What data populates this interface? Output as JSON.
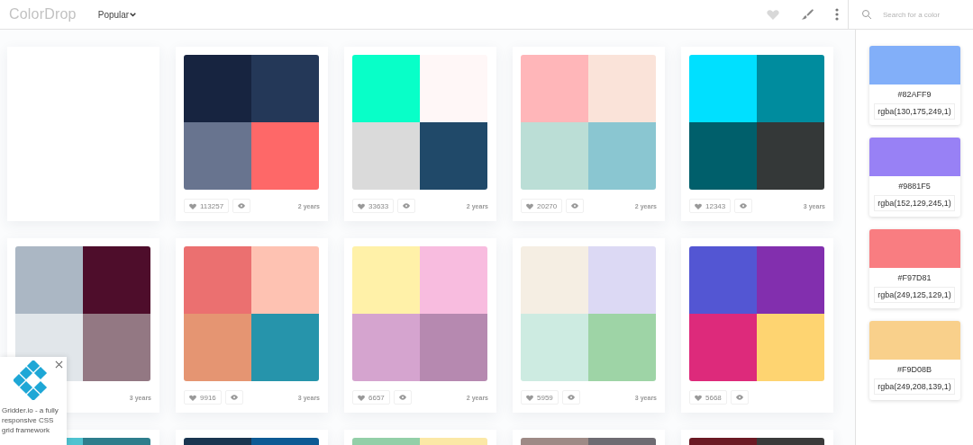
{
  "header": {
    "logo": "ColorDrop",
    "sort": "Popular",
    "search": {
      "placeholder": "Search for a color"
    }
  },
  "cards": [
    {
      "kind": "blank"
    },
    {
      "kind": "palette",
      "swatches": [
        {
          "color": "#172440"
        },
        {
          "color": "#243858"
        },
        {
          "color": "#68748f"
        },
        {
          "color": "#fe6868"
        }
      ],
      "likes": "113257",
      "age": "2 years"
    },
    {
      "kind": "palette",
      "swatches": [
        {
          "color": "#08ffc8"
        },
        {
          "color": "#fff7f7"
        },
        {
          "color": "#dadada"
        },
        {
          "color": "#204969"
        }
      ],
      "likes": "33633",
      "age": "2 years"
    },
    {
      "kind": "palette",
      "swatches": [
        {
          "color": "#ffb6b9"
        },
        {
          "color": "#fae3d9"
        },
        {
          "color": "#bbded6"
        },
        {
          "color": "#8ac6d1"
        }
      ],
      "likes": "20270",
      "age": "2 years"
    },
    {
      "kind": "palette",
      "swatches": [
        {
          "color": "#00e0ff"
        },
        {
          "color": "#008c9e"
        },
        {
          "color": "#005f6b"
        },
        {
          "color": "#343838"
        }
      ],
      "likes": "12343",
      "age": "3 years"
    },
    {
      "kind": "palette",
      "swatches": [
        {
          "color": "#abb7c4"
        },
        {
          "color": "#4e0d2b"
        },
        {
          "color": "#e1e6ea"
        },
        {
          "color": "#937883"
        }
      ],
      "age": "3 years"
    },
    {
      "kind": "palette",
      "swatches": [
        {
          "color": "#eb7070"
        },
        {
          "color": "#fec2b2"
        },
        {
          "color": "#e59572"
        },
        {
          "color": "#2694ab"
        }
      ],
      "likes": "9916",
      "age": "3 years"
    },
    {
      "kind": "palette",
      "swatches": [
        {
          "color": "#fff1a8"
        },
        {
          "color": "#f8bcdf"
        },
        {
          "color": "#d5a4cf"
        },
        {
          "color": "#b689b0"
        }
      ],
      "likes": "6657",
      "age": "2 years"
    },
    {
      "kind": "palette",
      "swatches": [
        {
          "color": "#f5eee3"
        },
        {
          "color": "#dcd9f4"
        },
        {
          "color": "#cdebe1"
        },
        {
          "color": "#9ed4a6"
        }
      ],
      "likes": "5959",
      "age": "3 years"
    },
    {
      "kind": "palette",
      "swatches": [
        {
          "color": "#5356d3"
        },
        {
          "color": "#822fae"
        },
        {
          "color": "#dd2a7b"
        },
        {
          "color": "#fed471"
        }
      ],
      "likes": "5668"
    },
    {
      "kind": "palette",
      "swatches": [
        {
          "color": "#4fc3d0"
        },
        {
          "color": "#2e7d8c"
        }
      ]
    },
    {
      "kind": "palette",
      "swatches": [
        {
          "color": "#1a3550"
        },
        {
          "color": "#0d5a94"
        }
      ]
    },
    {
      "kind": "palette",
      "swatches": [
        {
          "color": "#93cfa8"
        },
        {
          "color": "#fbe8a6"
        }
      ]
    },
    {
      "kind": "palette",
      "swatches": [
        {
          "color": "#9e8a86"
        },
        {
          "color": "#6e6b72"
        }
      ]
    },
    {
      "kind": "palette",
      "swatches": [
        {
          "color": "#6b1a24"
        },
        {
          "color": "#3a3a3a"
        }
      ]
    }
  ],
  "sidebar": {
    "swatches": [
      {
        "hex": "#82AFF9",
        "rgba": "rgba(130,175,249,1)"
      },
      {
        "hex": "#9881F5",
        "rgba": "rgba(152,129,245,1)"
      },
      {
        "hex": "#F97D81",
        "rgba": "rgba(249,125,129,1)"
      },
      {
        "hex": "#F9D08B",
        "rgba": "rgba(249,208,139,1)"
      }
    ]
  },
  "ad": {
    "text": "Gridder.io - a fully responsive CSS grid framework"
  }
}
